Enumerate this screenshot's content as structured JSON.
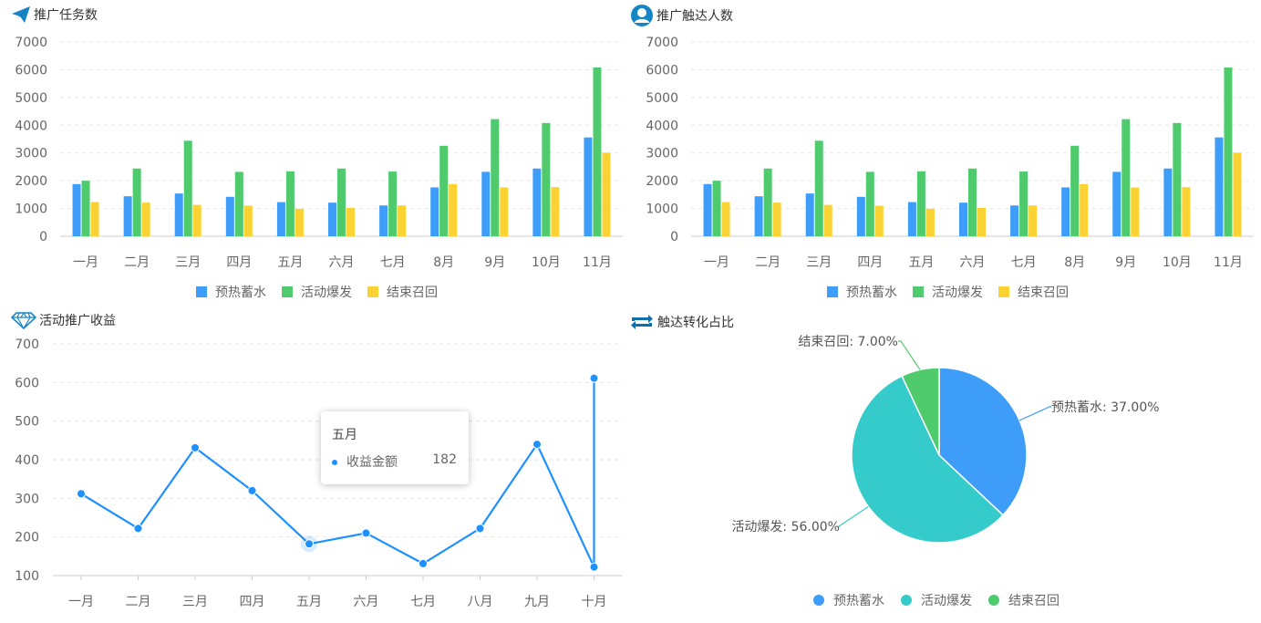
{
  "panels": {
    "tasks": {
      "title": "推广任务数"
    },
    "reach": {
      "title": "推广触达人数"
    },
    "revenue": {
      "title": "活动推广收益"
    },
    "ratio": {
      "title": "触达转化占比"
    }
  },
  "colors": {
    "blue": "#3e9df8",
    "green": "#4fcb6e",
    "yellow": "#fad233",
    "line": "#1e90ff",
    "teal": "#36cbcb"
  },
  "tooltip": {
    "title": "五月",
    "name": "收益金额",
    "value": "182"
  },
  "chart_data": [
    {
      "id": "tasks",
      "type": "bar",
      "title": "推广任务数",
      "categories": [
        "一月",
        "二月",
        "三月",
        "四月",
        "五月",
        "六月",
        "七月",
        "8月",
        "9月",
        "10月",
        "11月"
      ],
      "series": [
        {
          "name": "预热蓄水",
          "color": "#3e9df8",
          "values": [
            1880,
            1440,
            1540,
            1420,
            1230,
            1210,
            1110,
            1760,
            2320,
            2440,
            3560
          ]
        },
        {
          "name": "活动爆发",
          "color": "#4fcb6e",
          "values": [
            2000,
            2440,
            3440,
            2320,
            2340,
            2440,
            2330,
            3260,
            4220,
            4080,
            6080
          ]
        },
        {
          "name": "结束召回",
          "color": "#fad233",
          "values": [
            1230,
            1210,
            1130,
            1100,
            990,
            1020,
            1110,
            1880,
            1760,
            1770,
            3010
          ]
        }
      ],
      "ylim": [
        0,
        7000
      ],
      "yticks": [
        0,
        1000,
        2000,
        3000,
        4000,
        5000,
        6000,
        7000
      ],
      "legend": "bottom"
    },
    {
      "id": "reach",
      "type": "bar",
      "title": "推广触达人数",
      "categories": [
        "一月",
        "二月",
        "三月",
        "四月",
        "五月",
        "六月",
        "七月",
        "8月",
        "9月",
        "10月",
        "11月"
      ],
      "series": [
        {
          "name": "预热蓄水",
          "color": "#3e9df8",
          "values": [
            1880,
            1440,
            1540,
            1420,
            1230,
            1210,
            1110,
            1760,
            2320,
            2440,
            3560
          ]
        },
        {
          "name": "活动爆发",
          "color": "#4fcb6e",
          "values": [
            2000,
            2440,
            3440,
            2320,
            2340,
            2440,
            2330,
            3260,
            4220,
            4080,
            6080
          ]
        },
        {
          "name": "结束召回",
          "color": "#fad233",
          "values": [
            1230,
            1210,
            1130,
            1100,
            990,
            1020,
            1110,
            1880,
            1760,
            1770,
            3010
          ]
        }
      ],
      "ylim": [
        0,
        7000
      ],
      "yticks": [
        0,
        1000,
        2000,
        3000,
        4000,
        5000,
        6000,
        7000
      ],
      "legend": "bottom"
    },
    {
      "id": "revenue",
      "type": "line",
      "title": "活动推广收益",
      "categories": [
        "一月",
        "二月",
        "三月",
        "四月",
        "五月",
        "六月",
        "七月",
        "八月",
        "九月",
        "十月"
      ],
      "series": [
        {
          "name": "收益金额",
          "color": "#1e90ff",
          "points": [
            [
              "一月",
              312
            ],
            [
              "二月",
              222
            ],
            [
              "三月",
              431
            ],
            [
              "四月",
              320
            ],
            [
              "五月",
              182
            ],
            [
              "六月",
              210
            ],
            [
              "七月",
              131
            ],
            [
              "八月",
              222
            ],
            [
              "九月",
              440
            ],
            [
              "十月",
              122
            ],
            [
              "十月",
              611
            ]
          ]
        }
      ],
      "ylim": [
        100,
        700
      ],
      "yticks": [
        100,
        200,
        300,
        400,
        500,
        600,
        700
      ]
    },
    {
      "id": "ratio",
      "type": "pie",
      "title": "触达转化占比",
      "slices": [
        {
          "name": "预热蓄水",
          "value": 37,
          "label": "预热蓄水: 37.00%",
          "color": "#3e9df8"
        },
        {
          "name": "活动爆发",
          "value": 56,
          "label": "活动爆发: 56.00%",
          "color": "#36cbcb"
        },
        {
          "name": "结束召回",
          "value": 7,
          "label": "结束召回: 7.00%",
          "color": "#4fcb6e"
        }
      ],
      "legend": "bottom"
    }
  ]
}
